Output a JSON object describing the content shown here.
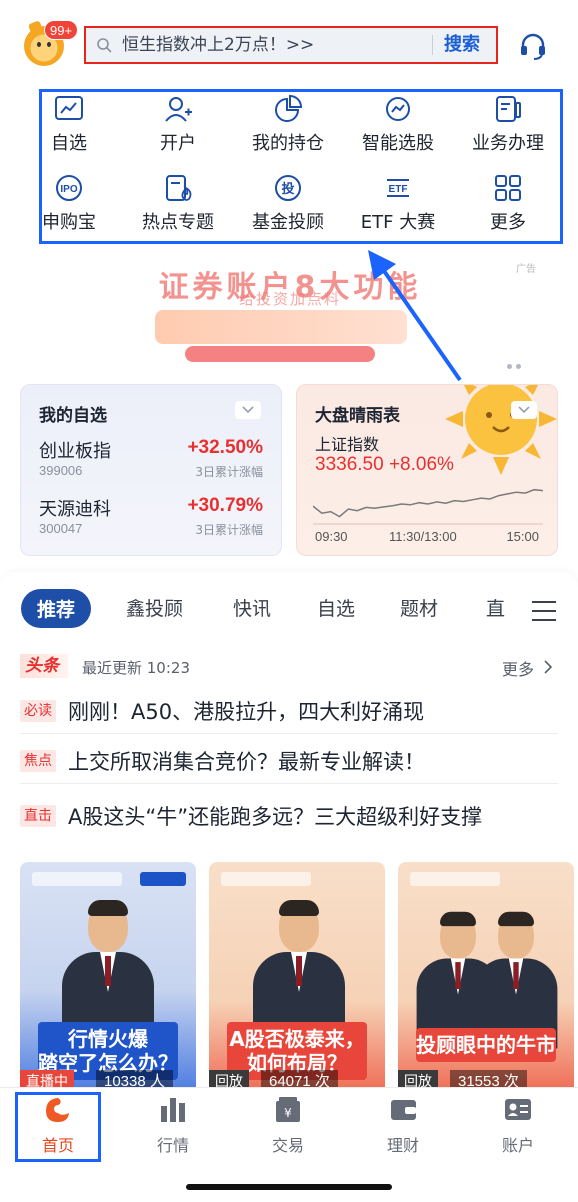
{
  "header": {
    "badge_count": "99+",
    "search_placeholder": "恒生指数冲上2万点！>>",
    "search_button": "搜索"
  },
  "functions": [
    {
      "label": "自选",
      "icon": "chart-line-icon"
    },
    {
      "label": "开户",
      "icon": "add-user-icon"
    },
    {
      "label": "我的持仓",
      "icon": "pie-chart-icon"
    },
    {
      "label": "智能选股",
      "icon": "smart-pick-icon"
    },
    {
      "label": "业务办理",
      "icon": "document-pen-icon"
    },
    {
      "label": "申购宝",
      "icon": "ipo-icon"
    },
    {
      "label": "热点专题",
      "icon": "hot-topic-icon"
    },
    {
      "label": "基金投顾",
      "icon": "fund-advisor-icon"
    },
    {
      "label": "ETF 大赛",
      "icon": "etf-icon"
    },
    {
      "label": "更多",
      "icon": "grid-more-icon"
    }
  ],
  "banner": {
    "title": "证券账户8大功能",
    "subtitle": "给投资加点料",
    "ad_label": "广告"
  },
  "watchlist": {
    "title": "我的自选",
    "stocks": [
      {
        "name": "创业板指",
        "code": "399006",
        "change": "+32.50%",
        "note": "3日累计涨幅"
      },
      {
        "name": "天源迪科",
        "code": "300047",
        "change": "+30.79%",
        "note": "3日累计涨幅"
      }
    ]
  },
  "market": {
    "title": "大盘晴雨表",
    "index_name": "上证指数",
    "index_value": "3336.50 +8.06%",
    "time_start": "09:30",
    "time_mid": "11:30/13:00",
    "time_end": "15:00",
    "sparkline": [
      0.55,
      0.72,
      0.68,
      0.8,
      0.62,
      0.66,
      0.58,
      0.6,
      0.57,
      0.54,
      0.5,
      0.52,
      0.47,
      0.5,
      0.45,
      0.48,
      0.42,
      0.44,
      0.4,
      0.36,
      0.38,
      0.3,
      0.26,
      0.22,
      0.24,
      0.16,
      0.18
    ]
  },
  "tabs": [
    "推荐",
    "鑫投顾",
    "快讯",
    "自选",
    "题材",
    "直"
  ],
  "headlines": {
    "logo": "头条",
    "updated": "最近更新 10:23",
    "more": "更多",
    "items": [
      {
        "tag": "必读",
        "text": "刚刚！A50、港股拉升，四大利好涌现"
      },
      {
        "tag": "焦点",
        "text": "上交所取消集合竞价？最新专业解读！"
      },
      {
        "tag": "直击",
        "text": "A股这头“牛”还能跑多远？三大超级利好支撑"
      }
    ]
  },
  "videos": [
    {
      "title_line1": "行情火爆",
      "title_line2": "踏空了怎么办？",
      "status": "直播中",
      "count": "10338 人"
    },
    {
      "title_line1": "A股否极泰来，",
      "title_line2": "如何布局？",
      "status": "回放",
      "count": "64071 次"
    },
    {
      "title_line1": "投顾眼中的牛市",
      "title_line2": "",
      "status": "回放",
      "count": "31553 次"
    }
  ],
  "bottom_nav": [
    {
      "label": "首页",
      "icon": "home-icon"
    },
    {
      "label": "行情",
      "icon": "market-bars-icon"
    },
    {
      "label": "交易",
      "icon": "trade-icon"
    },
    {
      "label": "理财",
      "icon": "wallet-icon"
    },
    {
      "label": "账户",
      "icon": "account-card-icon"
    }
  ],
  "colors": {
    "accent_blue": "#1d4ea8",
    "up_red": "#e8312f",
    "highlight_blue": "#1b63ff",
    "highlight_red": "#e8251b"
  }
}
